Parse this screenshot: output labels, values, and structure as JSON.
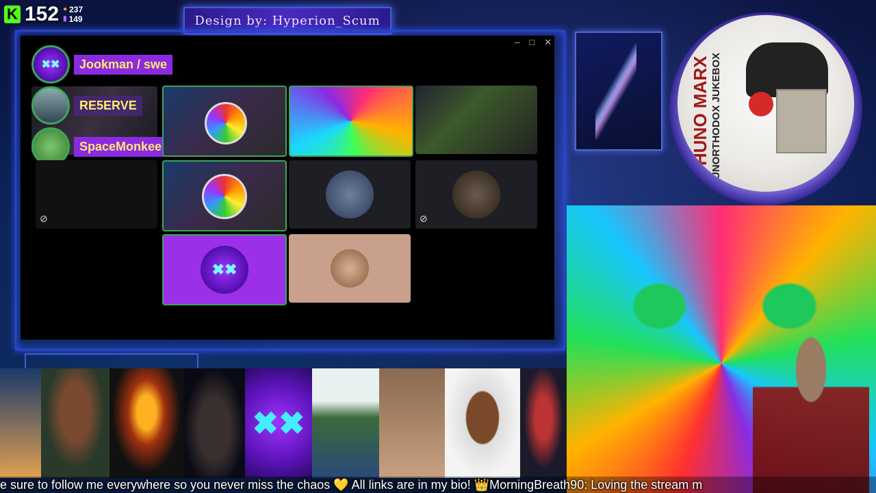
{
  "stats": {
    "count_main": "152",
    "viewers": "237",
    "followers": "149"
  },
  "banner": {
    "text": "Design by: Hyperion_Scum"
  },
  "discord": {
    "window_controls": [
      "–",
      "□",
      "✕"
    ],
    "participants": [
      {
        "name": "Jookman / swe"
      },
      {
        "name": "RE5ERVE"
      },
      {
        "name": "SpaceMonkee"
      }
    ]
  },
  "jukebox": {
    "label1": "UNORTHODOX JUKEBOX",
    "label2": "HUNO MARX"
  },
  "ticker": {
    "text": "e sure to follow me everywhere so you never miss the chaos 💛 All links are in my bio! 👑MorningBreath90: Loving the stream m"
  },
  "colors": {
    "kick_green": "#53fc18",
    "discord_speaking": "#3ba55c",
    "accent_purple": "#8a2be2",
    "frame_blue": "#3f5fd0"
  },
  "icons": [
    "kick-logo-icon",
    "person-icon",
    "bars-icon",
    "mute-icon",
    "heart-icon",
    "crown-icon"
  ]
}
